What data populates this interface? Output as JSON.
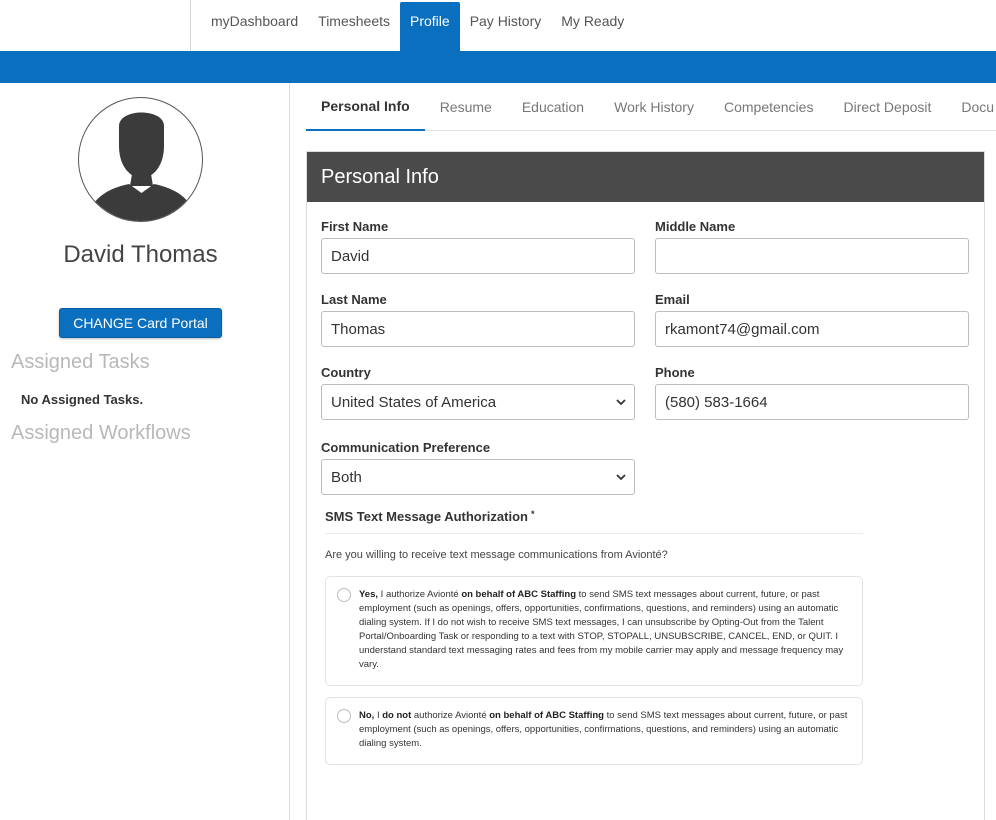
{
  "topnav": {
    "items": [
      {
        "label": "myDashboard"
      },
      {
        "label": "Timesheets"
      },
      {
        "label": "Profile"
      },
      {
        "label": "Pay History"
      },
      {
        "label": "My Ready"
      }
    ],
    "active_index": 2
  },
  "sidebar": {
    "name": "David Thomas",
    "change_button": "CHANGE Card Portal",
    "assigned_tasks_heading": "Assigned Tasks",
    "no_tasks_text": "No Assigned Tasks.",
    "assigned_workflows_heading": "Assigned Workflows"
  },
  "subtabs": {
    "items": [
      {
        "label": "Personal Info"
      },
      {
        "label": "Resume"
      },
      {
        "label": "Education"
      },
      {
        "label": "Work History"
      },
      {
        "label": "Competencies"
      },
      {
        "label": "Direct Deposit"
      },
      {
        "label": "Docu"
      }
    ],
    "active_index": 0
  },
  "form": {
    "header": "Personal Info",
    "first_name": {
      "label": "First Name",
      "value": "David"
    },
    "middle_name": {
      "label": "Middle Name",
      "value": ""
    },
    "last_name": {
      "label": "Last Name",
      "value": "Thomas"
    },
    "email": {
      "label": "Email",
      "value": "rkamont74@gmail.com"
    },
    "country": {
      "label": "Country",
      "value": "United States of America"
    },
    "phone": {
      "label": "Phone",
      "value": "(580) 583-1664"
    },
    "communication": {
      "label": "Communication Preference",
      "value": "Both"
    }
  },
  "sms": {
    "title": "SMS Text Message Authorization",
    "required_mark": "*",
    "question": "Are you willing to receive text message communications from Avionté?",
    "yes": {
      "lead": "Yes,",
      "t1": " I authorize Avionté ",
      "b1": "on behalf of ABC Staffing",
      "t2": " to send SMS text messages about current, future, or past employment (such as openings, offers, opportunities, confirmations, questions, and reminders) using an automatic dialing system. If I do not wish to receive SMS text messages, I can unsubscribe by Opting-Out from the Talent Portal/Onboarding Task or responding to a text with STOP, STOPALL, UNSUBSCRIBE, CANCEL, END, or QUIT. I understand standard text messaging rates and fees from my mobile carrier may apply and message frequency may vary."
    },
    "no": {
      "lead": "No,",
      "t1": " I ",
      "b1": "do not",
      "t2": " authorize Avionté ",
      "b2": "on behalf of ABC Staffing",
      "t3": " to send SMS text messages about current, future, or past employment (such as openings, offers, opportunities, confirmations, questions, and reminders) using an automatic dialing system."
    }
  },
  "colors": {
    "brand_blue": "#0b6fbf",
    "header_gray": "#4a4a4a"
  }
}
